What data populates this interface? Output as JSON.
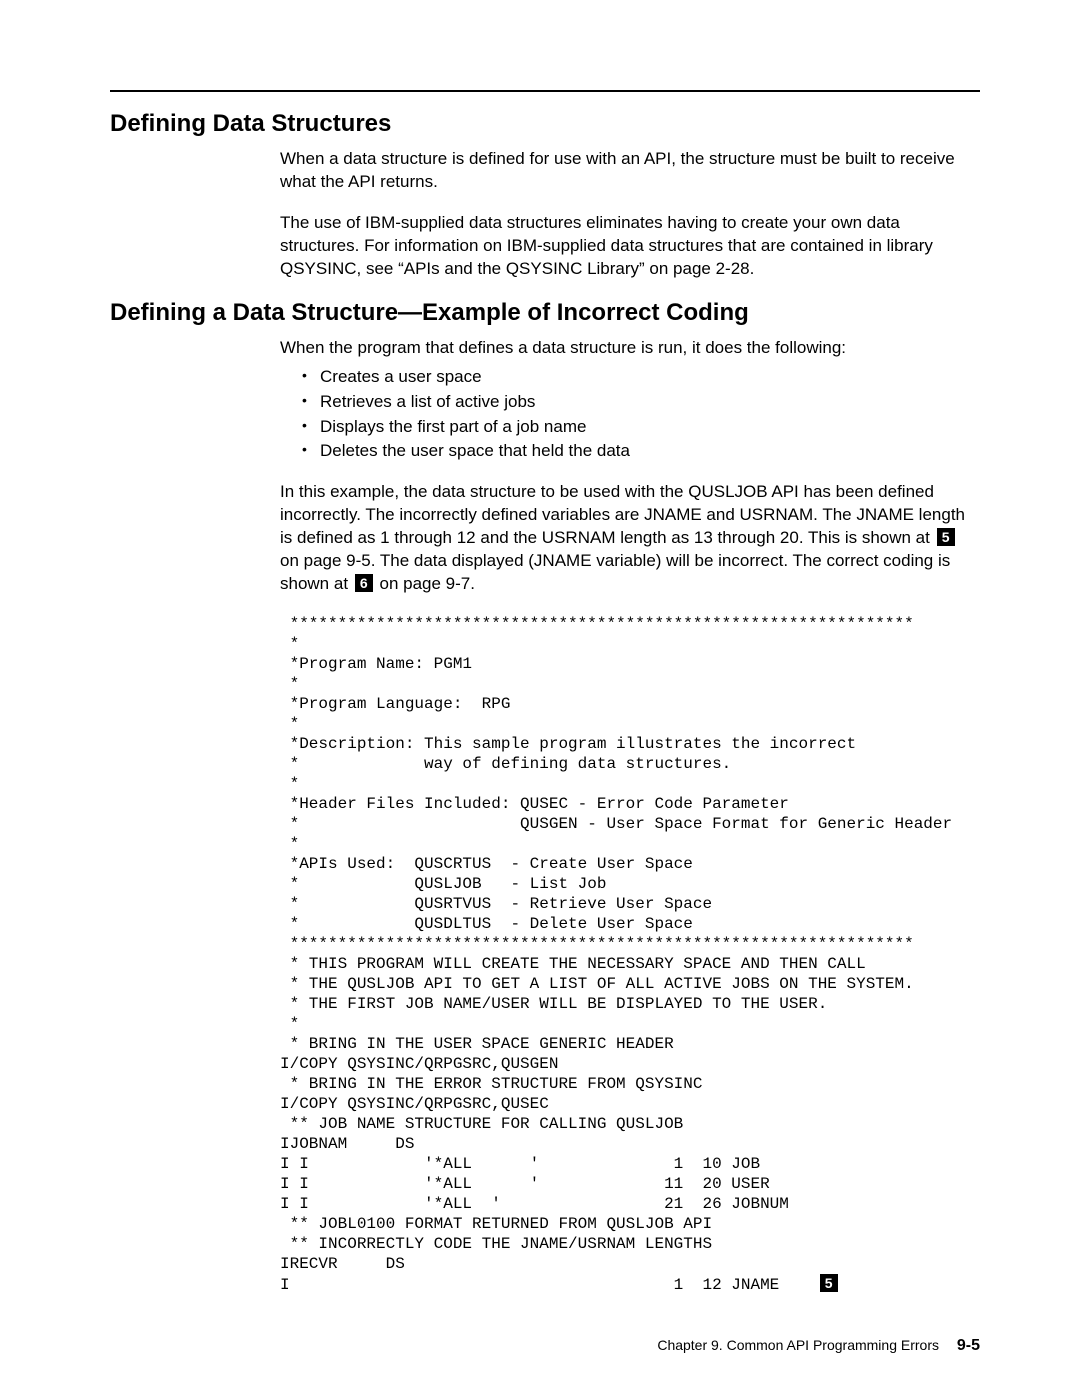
{
  "heading1": "Defining Data Structures",
  "para1": "When a data structure is defined for use with an API, the structure must be built to receive what the API returns.",
  "para2": "The use of IBM-supplied data structures eliminates having to create your own data structures.  For information on IBM-supplied data structures that are contained in library QSYSINC, see “APIs and the QSYSINC Library” on page 2-28.",
  "heading2": "Defining a Data Structure—Example of Incorrect Coding",
  "para3": "When the program that defines a data structure is run, it does the following:",
  "bullets": {
    "b1": "Creates a user space",
    "b2": "Retrieves a list of active jobs",
    "b3": "Displays the first part of a job name",
    "b4": "Deletes the user space that held the data"
  },
  "para4a": "In this example, the data structure to be used with the QUSLJOB API has been defined incorrectly.  The incorrectly defined variables are JNAME and USRNAM.  The JNAME length is defined as 1 through 12 and the USRNAM length as 13 through 20.  This is shown at ",
  "para4b": " on page 9-5.  The data displayed (JNAME variable) will be incorrect.  The correct coding is shown at ",
  "para4c": " on page 9-7.",
  "callout5": "5",
  "callout6": "6",
  "code_lines": {
    "l01": " *****************************************************************",
    "l02": " *",
    "l03": " *Program Name: PGM1",
    "l04": " *",
    "l05": " *Program Language:  RPG",
    "l06": " *",
    "l07": " *Description: This sample program illustrates the incorrect",
    "l08": " *             way of defining data structures.",
    "l09": " *",
    "l10": " *Header Files Included: QUSEC - Error Code Parameter",
    "l11": " *                       QUSGEN - User Space Format for Generic Header",
    "l12": " *",
    "l13": " *APIs Used:  QUSCRTUS  - Create User Space",
    "l14": " *            QUSLJOB   - List Job",
    "l15": " *            QUSRTVUS  - Retrieve User Space",
    "l16": " *            QUSDLTUS  - Delete User Space",
    "l17": " *****************************************************************",
    "l18": " * THIS PROGRAM WILL CREATE THE NECESSARY SPACE AND THEN CALL",
    "l19": " * THE QUSLJOB API TO GET A LIST OF ALL ACTIVE JOBS ON THE SYSTEM.",
    "l20": " * THE FIRST JOB NAME/USER WILL BE DISPLAYED TO THE USER.",
    "l21": " *",
    "l22": " * BRING IN THE USER SPACE GENERIC HEADER",
    "l23": "I/COPY QSYSINC/QRPGSRC,QUSGEN",
    "l24": " * BRING IN THE ERROR STRUCTURE FROM QSYSINC",
    "l25": "I/COPY QSYSINC/QRPGSRC,QUSEC",
    "l26": " ** JOB NAME STRUCTURE FOR CALLING QUSLJOB",
    "l27": "IJOBNAM     DS",
    "l28": "I I            '*ALL      '              1  10 JOB",
    "l29": "I I            '*ALL      '             11  20 USER",
    "l30": "I I            '*ALL  '                 21  26 JOBNUM",
    "l31": " ** JOBL0100 FORMAT RETURNED FROM QUSLJOB API",
    "l32": " ** INCORRECTLY CODE THE JNAME/USRNAM LENGTHS",
    "l33": "IRECVR     DS",
    "l34a": "I                                        1  12 JNAME    ",
    "l34_callout": "5"
  },
  "footer": {
    "chapter": "Chapter 9.  Common API Programming Errors",
    "page": "9-5"
  }
}
